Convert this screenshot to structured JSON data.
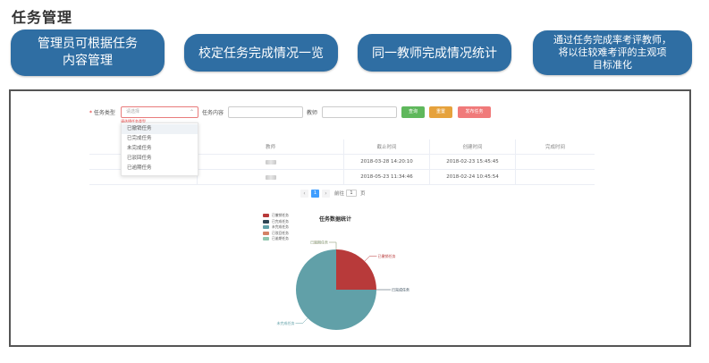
{
  "header": {
    "title": "任务管理"
  },
  "features": [
    {
      "text": "管理员可根据任务\n内容管理"
    },
    {
      "text": "校定任务完成情况一览"
    },
    {
      "text": "同一教师完成情况统计"
    },
    {
      "text": "通过任务完成率考评教师，\n将以往较难考评的主观项\n目标准化"
    }
  ],
  "filter": {
    "type_label": "任务类型",
    "type_placeholder": "请选择",
    "type_error": "请选择任务类型",
    "content_label": "任务内容",
    "teacher_label": "教师",
    "query_button": "查询",
    "reset_button": "重置",
    "publish_button": "发布任务"
  },
  "dropdown": {
    "options": [
      "已撤销任务",
      "已完成任务",
      "未完成任务",
      "已驳回任务",
      "已逾期任务"
    ]
  },
  "table": {
    "columns": [
      "",
      "教师",
      "截止时间",
      "创建时间",
      "完成时间"
    ],
    "rows": [
      {
        "deadline": "2018-03-28 14:20:10",
        "created": "2018-02-23 15:45:45",
        "done": ""
      },
      {
        "deadline": "2018-05-23 11:34:46",
        "created": "2018-02-24 10:45:54",
        "done": ""
      }
    ]
  },
  "pagination": {
    "current": "1",
    "goto_label": "前往",
    "goto_value": "1",
    "page_suffix": "页",
    "prev_glyph": "‹",
    "next_glyph": "›"
  },
  "chart_data": {
    "type": "pie",
    "title": "任务数据统计",
    "legend": [
      "已撤销任务",
      "已完成任务",
      "未完成任务",
      "已驳回任务",
      "已逾期任务"
    ],
    "colors": [
      "#b83a3a",
      "#2f4554",
      "#61a0a8",
      "#d48265",
      "#91c7ae"
    ],
    "values": [
      1,
      0,
      3,
      0,
      0
    ],
    "slice_labels": [
      "已撤销任务",
      "已完成任务",
      "未完成任务",
      "已驳回任务",
      "已逾期任务"
    ],
    "legend_position": "top-left"
  }
}
